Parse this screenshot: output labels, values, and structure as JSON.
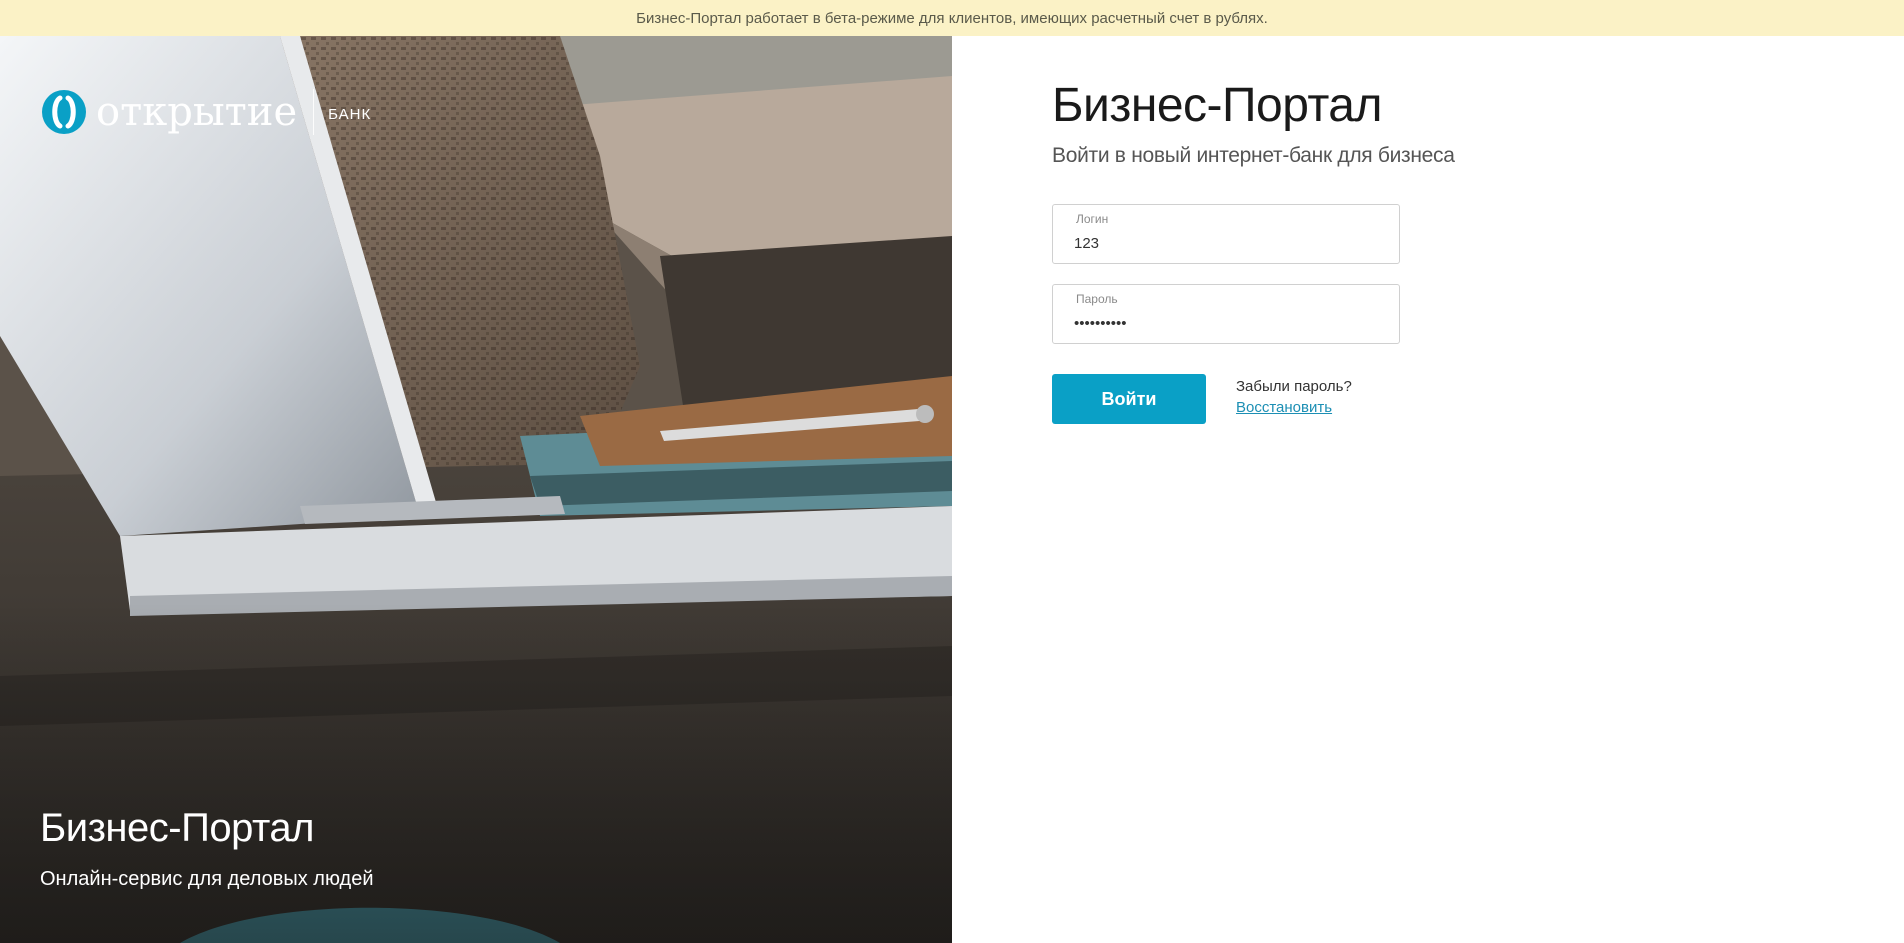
{
  "banner": {
    "text": "Бизнес-Портал работает в бета-режиме для клиентов, имеющих расчетный счет в рублях."
  },
  "brand": {
    "logo_word": "открытие",
    "logo_suffix": "БАНК",
    "icon": "otkritie-logo-icon",
    "accent_color": "#0aa0c6"
  },
  "hero": {
    "title": "Бизнес-Портал",
    "subtitle": "Онлайн-сервис для деловых людей"
  },
  "login": {
    "title": "Бизнес-Портал",
    "subtitle": "Войти в новый интернет-банк для бизнеса",
    "login_field": {
      "label": "Логин",
      "value": "123"
    },
    "password_field": {
      "label": "Пароль",
      "value": "••••••••••"
    },
    "submit_label": "Войти",
    "forgot_text": "Забыли пароль?",
    "recover_link": "Восстановить"
  }
}
